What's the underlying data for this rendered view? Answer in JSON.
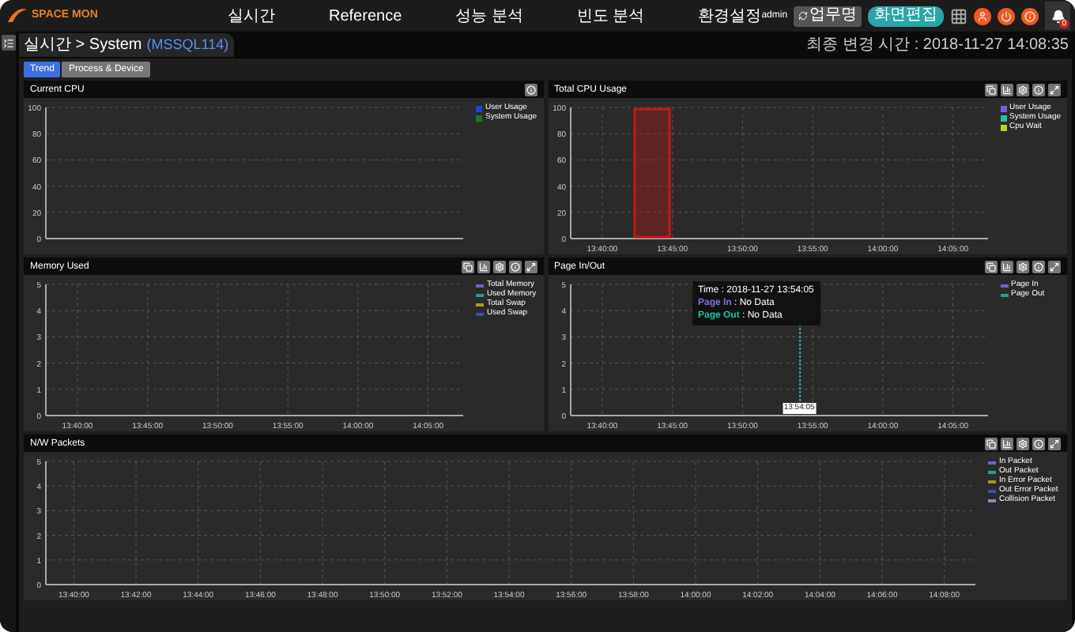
{
  "app": {
    "logo": "SPACE MON",
    "menu": [
      "실시간",
      "Reference",
      "성능 분석",
      "빈도 분석",
      "환경설정"
    ],
    "user": "admin",
    "buttons": [
      {
        "kind": "task",
        "label": "업무명"
      },
      {
        "kind": "edit",
        "label": "화면편집"
      }
    ],
    "notifications": "0"
  },
  "breadcrumb": {
    "path": "실시간 > System",
    "target": "(MSSQL114)"
  },
  "last_changed": "최종 변경 시간 : 2018-11-27 14:08:35",
  "tabs": [
    {
      "label": "Trend",
      "selected": true
    },
    {
      "label": "Process & Device",
      "selected": false
    }
  ],
  "panels": [
    {
      "title": "Current CPU",
      "tools": [
        {
          "kind": "info"
        }
      ],
      "chart_data": {
        "type": "bar",
        "grid": true,
        "ylim": [
          0,
          100
        ],
        "yticks": [
          0,
          20,
          40,
          60,
          80,
          100
        ],
        "series": [
          {
            "name": "User Usage",
            "color": "#2040e0"
          },
          {
            "name": "System Usage",
            "color": "#1a7a1a"
          }
        ]
      }
    },
    {
      "title": "Total CPU Usage",
      "tools": [
        {
          "kind": "copy"
        },
        {
          "kind": "chart"
        },
        {
          "kind": "settings"
        },
        {
          "kind": "info"
        },
        {
          "kind": "expand"
        }
      ],
      "selection_shown": true,
      "chart_data": {
        "type": "area",
        "grid": true,
        "ylim": [
          0,
          100
        ],
        "categories": [
          "13:40:00",
          "13:45:00",
          "13:50:00",
          "13:55:00",
          "14:00:00",
          "14:05:00"
        ],
        "yticks": [
          0,
          20,
          40,
          60,
          80,
          100
        ],
        "series": [
          {
            "name": "User Usage",
            "color": "#7b5ce0",
            "values": [
              null,
              null,
              null,
              null,
              null,
              null
            ]
          },
          {
            "name": "System Usage",
            "color": "#20c0a0",
            "values": [
              null,
              null,
              null,
              null,
              null,
              null
            ]
          },
          {
            "name": "Cpu Wait",
            "color": "#c0d020",
            "values": [
              null,
              null,
              null,
              null,
              null,
              null
            ]
          }
        ]
      }
    },
    {
      "title": "Memory Used",
      "tools": [
        {
          "kind": "copy"
        },
        {
          "kind": "chart"
        },
        {
          "kind": "settings"
        },
        {
          "kind": "info"
        },
        {
          "kind": "expand"
        }
      ],
      "chart_data": {
        "type": "line",
        "grid": true,
        "ylim": [
          0,
          5
        ],
        "categories": [
          "13:40:00",
          "13:45:00",
          "13:50:00",
          "13:55:00",
          "14:00:00",
          "14:05:00"
        ],
        "yticks": [
          0,
          1,
          2,
          3,
          4,
          5
        ],
        "series": [
          {
            "name": "Total Memory",
            "color": "#7060d0",
            "values": [
              null,
              null,
              null,
              null,
              null,
              null
            ]
          },
          {
            "name": "Used Memory",
            "color": "#20a090",
            "values": [
              null,
              null,
              null,
              null,
              null,
              null
            ]
          },
          {
            "name": "Total Swap",
            "color": "#a0a020",
            "values": [
              null,
              null,
              null,
              null,
              null,
              null
            ]
          },
          {
            "name": "Used Swap",
            "color": "#3050c0",
            "values": [
              null,
              null,
              null,
              null,
              null,
              null
            ]
          }
        ]
      }
    },
    {
      "title": "Page In/Out",
      "tools": [
        {
          "kind": "copy"
        },
        {
          "kind": "chart"
        },
        {
          "kind": "settings"
        },
        {
          "kind": "info"
        },
        {
          "kind": "expand"
        }
      ],
      "crosshair_label": "13:54:05",
      "tooltip": {
        "time": "Time : 2018-11-27 13:54:05",
        "rows": [
          {
            "label": "Page In",
            "value": " : No Data",
            "color": "#8070e0"
          },
          {
            "label": "Page Out",
            "value": " : No Data",
            "color": "#20c0a0"
          }
        ]
      },
      "chart_data": {
        "type": "line",
        "grid": true,
        "ylim": [
          0,
          5
        ],
        "categories": [
          "13:40:00",
          "13:45:00",
          "13:50:00",
          "13:55:00",
          "14:00:00",
          "14:05:00"
        ],
        "yticks": [
          0,
          1,
          2,
          3,
          4,
          5
        ],
        "series": [
          {
            "name": "Page In",
            "color": "#7060d0",
            "values": [
              null,
              null,
              null,
              null,
              null,
              null
            ]
          },
          {
            "name": "Page Out",
            "color": "#20a090",
            "values": [
              null,
              null,
              null,
              null,
              null,
              null
            ]
          }
        ]
      }
    },
    {
      "title": "N/W Packets",
      "tools": [
        {
          "kind": "copy"
        },
        {
          "kind": "chart"
        },
        {
          "kind": "settings"
        },
        {
          "kind": "info"
        },
        {
          "kind": "expand"
        }
      ],
      "chart_data": {
        "type": "line",
        "grid": true,
        "ylim": [
          0,
          5
        ],
        "categories": [
          "13:40:00",
          "13:42:00",
          "13:44:00",
          "13:46:00",
          "13:48:00",
          "13:50:00",
          "13:52:00",
          "13:54:00",
          "13:56:00",
          "13:58:00",
          "14:00:00",
          "14:02:00",
          "14:04:00",
          "14:06:00",
          "14:08:00"
        ],
        "yticks": [
          0,
          1,
          2,
          3,
          4,
          5
        ],
        "series": [
          {
            "name": "In Packet",
            "color": "#7060d0",
            "values": [
              null,
              null,
              null,
              null,
              null,
              null,
              null,
              null,
              null,
              null,
              null,
              null,
              null,
              null,
              null
            ]
          },
          {
            "name": "Out Packet",
            "color": "#20a090",
            "values": [
              null,
              null,
              null,
              null,
              null,
              null,
              null,
              null,
              null,
              null,
              null,
              null,
              null,
              null,
              null
            ]
          },
          {
            "name": "In Error Packet",
            "color": "#a0a020",
            "values": [
              null,
              null,
              null,
              null,
              null,
              null,
              null,
              null,
              null,
              null,
              null,
              null,
              null,
              null,
              null
            ]
          },
          {
            "name": "Out Error Packet",
            "color": "#3050c0",
            "values": [
              null,
              null,
              null,
              null,
              null,
              null,
              null,
              null,
              null,
              null,
              null,
              null,
              null,
              null,
              null
            ]
          },
          {
            "name": "Collision Packet",
            "color": "#8090c0",
            "values": [
              null,
              null,
              null,
              null,
              null,
              null,
              null,
              null,
              null,
              null,
              null,
              null,
              null,
              null,
              null
            ]
          }
        ]
      }
    }
  ]
}
